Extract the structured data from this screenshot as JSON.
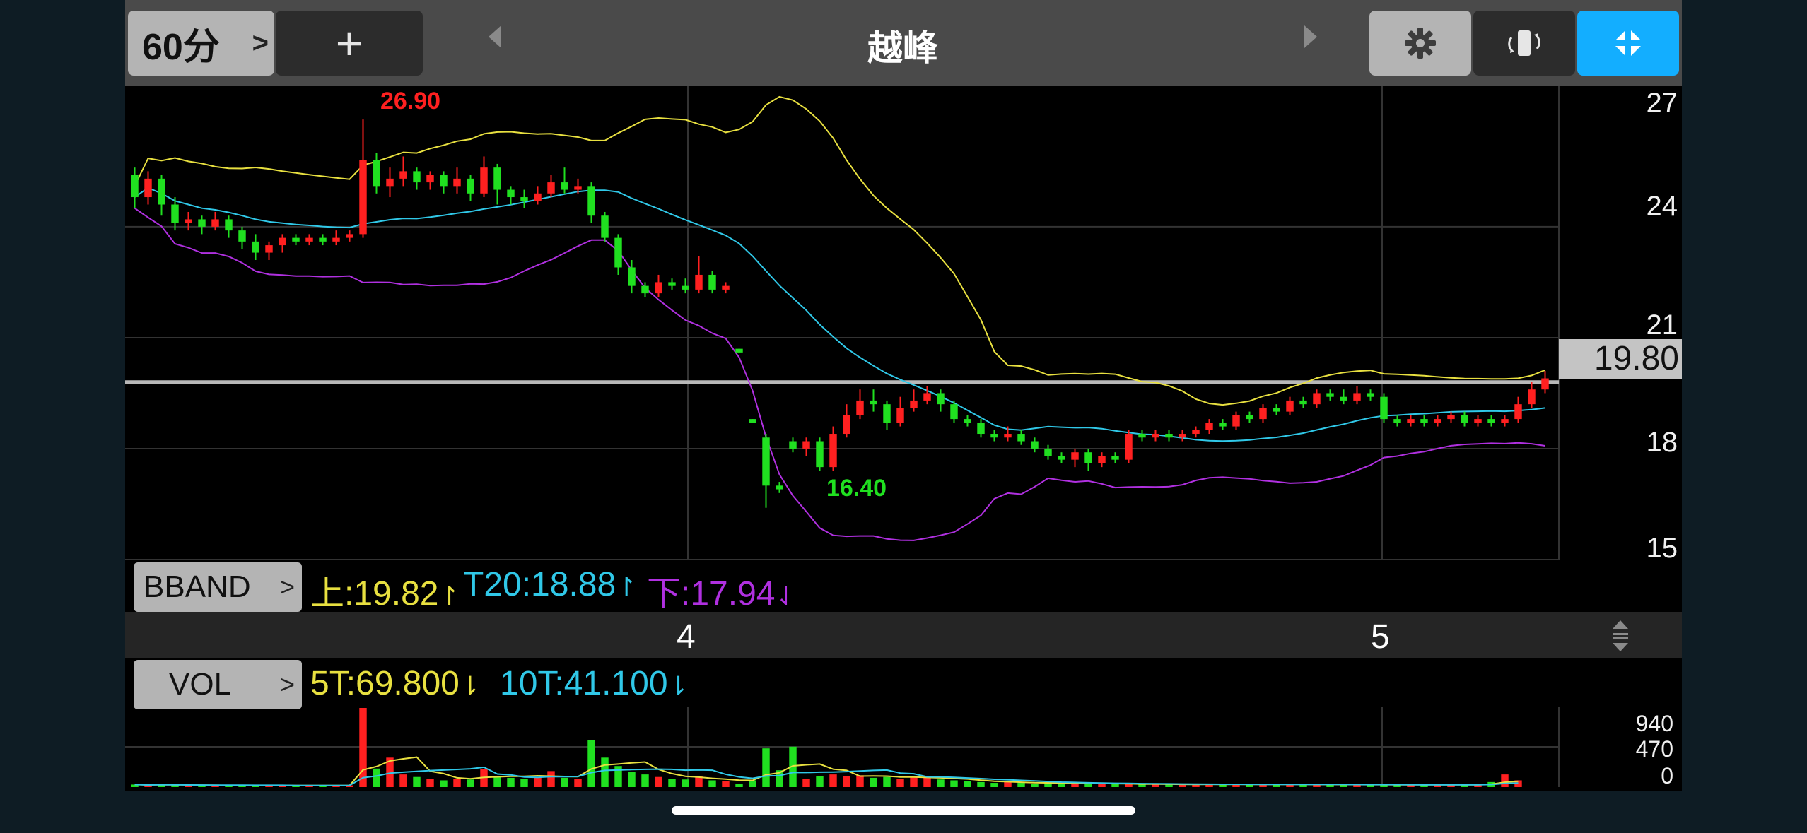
{
  "toolbar": {
    "period_label": "60分",
    "add_label": "+",
    "title": "越峰"
  },
  "price_axis": [
    "27",
    "24",
    "21",
    "18",
    "15"
  ],
  "last_price": "19.80",
  "markers": {
    "high": "26.90",
    "low": "16.40"
  },
  "bband": {
    "button": "BBAND",
    "upper": "上:19.82",
    "mid": "T20:18.88",
    "lower": "下:17.94"
  },
  "time_axis": [
    "4",
    "5"
  ],
  "vol": {
    "button": "VOL",
    "ma5": "5T:69.800",
    "ma10": "10T:41.100",
    "axis": [
      "940",
      "470",
      "0"
    ]
  },
  "colors": {
    "up": "#ff2020",
    "down": "#20e020",
    "upper_band": "#e8e040",
    "mid_band": "#30c8e8",
    "lower_band": "#b030e0",
    "accent": "#13aeff"
  },
  "icons": [
    "chevron-right-icon",
    "triangle-left-icon",
    "triangle-right-icon",
    "gear-icon",
    "rotate-screen-icon",
    "collapse-icon",
    "drag-handle-icon"
  ],
  "chart_data": {
    "type": "candlestick",
    "price_ylim": [
      15,
      27.8
    ],
    "last_price": 19.8,
    "high": 26.9,
    "low": 16.4,
    "bands_end": {
      "upper": 19.82,
      "mid": 18.88,
      "lower": 17.94
    },
    "x_ticks": [
      "4",
      "5"
    ],
    "volume_ylim": [
      0,
      940
    ],
    "candles": [
      [
        25.4,
        24.8,
        25.6,
        24.5
      ],
      [
        24.8,
        25.3,
        25.5,
        24.6
      ],
      [
        25.3,
        24.6,
        25.4,
        24.3
      ],
      [
        24.6,
        24.1,
        24.8,
        23.9
      ],
      [
        24.1,
        24.2,
        24.4,
        23.9
      ],
      [
        24.2,
        24.0,
        24.3,
        23.8
      ],
      [
        24.0,
        24.2,
        24.4,
        23.9
      ],
      [
        24.2,
        23.9,
        24.3,
        23.7
      ],
      [
        23.9,
        23.6,
        24.0,
        23.4
      ],
      [
        23.6,
        23.3,
        23.8,
        23.1
      ],
      [
        23.3,
        23.5,
        23.6,
        23.1
      ],
      [
        23.5,
        23.7,
        23.8,
        23.3
      ],
      [
        23.7,
        23.6,
        23.8,
        23.5
      ],
      [
        23.6,
        23.7,
        23.8,
        23.5
      ],
      [
        23.7,
        23.6,
        23.8,
        23.5
      ],
      [
        23.6,
        23.7,
        23.9,
        23.5
      ],
      [
        23.7,
        23.8,
        23.9,
        23.6
      ],
      [
        23.8,
        25.8,
        26.9,
        23.7
      ],
      [
        25.8,
        25.1,
        26.0,
        24.9
      ],
      [
        25.1,
        25.3,
        25.6,
        24.8
      ],
      [
        25.3,
        25.5,
        25.9,
        25.1
      ],
      [
        25.5,
        25.2,
        25.6,
        25.0
      ],
      [
        25.2,
        25.4,
        25.5,
        25.0
      ],
      [
        25.4,
        25.1,
        25.5,
        24.9
      ],
      [
        25.1,
        25.3,
        25.6,
        24.9
      ],
      [
        25.3,
        24.9,
        25.4,
        24.7
      ],
      [
        24.9,
        25.6,
        25.9,
        24.8
      ],
      [
        25.6,
        25.0,
        25.7,
        24.6
      ],
      [
        25.0,
        24.8,
        25.1,
        24.6
      ],
      [
        24.8,
        24.7,
        25.0,
        24.5
      ],
      [
        24.7,
        24.9,
        25.1,
        24.6
      ],
      [
        24.9,
        25.2,
        25.4,
        24.8
      ],
      [
        25.2,
        25.0,
        25.6,
        24.9
      ],
      [
        25.0,
        25.1,
        25.3,
        24.9
      ],
      [
        25.1,
        24.3,
        25.2,
        24.1
      ],
      [
        24.3,
        23.7,
        24.4,
        23.6
      ],
      [
        23.7,
        22.9,
        23.8,
        22.7
      ],
      [
        22.9,
        22.4,
        23.1,
        22.2
      ],
      [
        22.4,
        22.2,
        22.5,
        22.1
      ],
      [
        22.2,
        22.5,
        22.7,
        22.1
      ],
      [
        22.5,
        22.4,
        22.6,
        22.3
      ],
      [
        22.4,
        22.3,
        22.6,
        22.2
      ],
      [
        22.3,
        22.7,
        23.2,
        22.2
      ],
      [
        22.7,
        22.3,
        22.8,
        22.2
      ],
      [
        22.3,
        22.4,
        22.5,
        22.2
      ],
      [
        20.7,
        20.6,
        20.7,
        20.6
      ],
      [
        18.8,
        18.7,
        18.8,
        18.7
      ],
      [
        18.3,
        17.0,
        18.4,
        16.4
      ],
      [
        17.0,
        16.9,
        17.1,
        16.8
      ],
      [
        18.2,
        18.0,
        18.3,
        17.9
      ],
      [
        18.0,
        18.2,
        18.3,
        17.8
      ],
      [
        18.2,
        17.5,
        18.3,
        17.4
      ],
      [
        17.5,
        18.4,
        18.6,
        17.4
      ],
      [
        18.4,
        18.9,
        19.2,
        18.3
      ],
      [
        18.9,
        19.3,
        19.6,
        18.8
      ],
      [
        19.3,
        19.2,
        19.6,
        19.0
      ],
      [
        19.2,
        18.7,
        19.3,
        18.5
      ],
      [
        18.7,
        19.1,
        19.4,
        18.6
      ],
      [
        19.1,
        19.3,
        19.6,
        19.0
      ],
      [
        19.3,
        19.5,
        19.7,
        19.2
      ],
      [
        19.5,
        19.2,
        19.6,
        19.0
      ],
      [
        19.2,
        18.8,
        19.3,
        18.7
      ],
      [
        18.8,
        18.7,
        18.9,
        18.6
      ],
      [
        18.7,
        18.4,
        18.8,
        18.3
      ],
      [
        18.4,
        18.3,
        18.5,
        18.2
      ],
      [
        18.3,
        18.4,
        18.6,
        18.2
      ],
      [
        18.4,
        18.2,
        18.5,
        18.1
      ],
      [
        18.2,
        18.0,
        18.3,
        17.9
      ],
      [
        18.0,
        17.8,
        18.1,
        17.7
      ],
      [
        17.8,
        17.7,
        17.9,
        17.6
      ],
      [
        17.7,
        17.9,
        18.0,
        17.5
      ],
      [
        17.9,
        17.6,
        18.0,
        17.4
      ],
      [
        17.6,
        17.8,
        17.9,
        17.5
      ],
      [
        17.8,
        17.7,
        17.9,
        17.6
      ],
      [
        17.7,
        18.4,
        18.5,
        17.6
      ],
      [
        18.4,
        18.3,
        18.5,
        18.2
      ],
      [
        18.3,
        18.4,
        18.5,
        18.2
      ],
      [
        18.4,
        18.3,
        18.5,
        18.2
      ],
      [
        18.3,
        18.4,
        18.5,
        18.2
      ],
      [
        18.4,
        18.5,
        18.6,
        18.3
      ],
      [
        18.5,
        18.7,
        18.8,
        18.4
      ],
      [
        18.7,
        18.6,
        18.8,
        18.5
      ],
      [
        18.6,
        18.9,
        19.0,
        18.5
      ],
      [
        18.9,
        18.8,
        19.0,
        18.7
      ],
      [
        18.8,
        19.1,
        19.2,
        18.7
      ],
      [
        19.1,
        19.0,
        19.2,
        18.9
      ],
      [
        19.0,
        19.3,
        19.4,
        18.9
      ],
      [
        19.3,
        19.2,
        19.4,
        19.1
      ],
      [
        19.2,
        19.5,
        19.6,
        19.1
      ],
      [
        19.5,
        19.4,
        19.6,
        19.3
      ],
      [
        19.4,
        19.3,
        19.6,
        19.2
      ],
      [
        19.3,
        19.5,
        19.7,
        19.2
      ],
      [
        19.5,
        19.4,
        19.6,
        19.3
      ],
      [
        19.4,
        18.8,
        19.5,
        18.7
      ],
      [
        18.8,
        18.7,
        18.9,
        18.6
      ],
      [
        18.7,
        18.8,
        18.9,
        18.6
      ],
      [
        18.8,
        18.7,
        18.9,
        18.6
      ],
      [
        18.7,
        18.8,
        18.9,
        18.6
      ],
      [
        18.8,
        18.9,
        19.0,
        18.7
      ],
      [
        18.9,
        18.7,
        19.0,
        18.6
      ],
      [
        18.7,
        18.8,
        18.9,
        18.6
      ],
      [
        18.8,
        18.7,
        18.9,
        18.6
      ],
      [
        18.7,
        18.8,
        18.9,
        18.6
      ],
      [
        18.8,
        19.2,
        19.4,
        18.7
      ],
      [
        19.2,
        19.6,
        19.8,
        19.1
      ],
      [
        19.6,
        19.9,
        20.1,
        19.5
      ]
    ],
    "volume": [
      30,
      20,
      35,
      25,
      15,
      20,
      15,
      25,
      20,
      15,
      25,
      20,
      15,
      20,
      18,
      22,
      20,
      940,
      220,
      350,
      150,
      120,
      100,
      80,
      100,
      90,
      210,
      130,
      110,
      100,
      120,
      190,
      110,
      100,
      560,
      350,
      250,
      180,
      150,
      120,
      100,
      90,
      130,
      80,
      70,
      40,
      80,
      460,
      200,
      480,
      100,
      130,
      150,
      130,
      140,
      110,
      120,
      100,
      130,
      110,
      90,
      80,
      70,
      60,
      50,
      60,
      50,
      40,
      50,
      40,
      50,
      40,
      35,
      40,
      35,
      30,
      35,
      30,
      35,
      30,
      35,
      30,
      35,
      30,
      30,
      35,
      30,
      30,
      28,
      30,
      30,
      28,
      25,
      30,
      25,
      30,
      25,
      28,
      25,
      30,
      25,
      60,
      150,
      80
    ]
  }
}
